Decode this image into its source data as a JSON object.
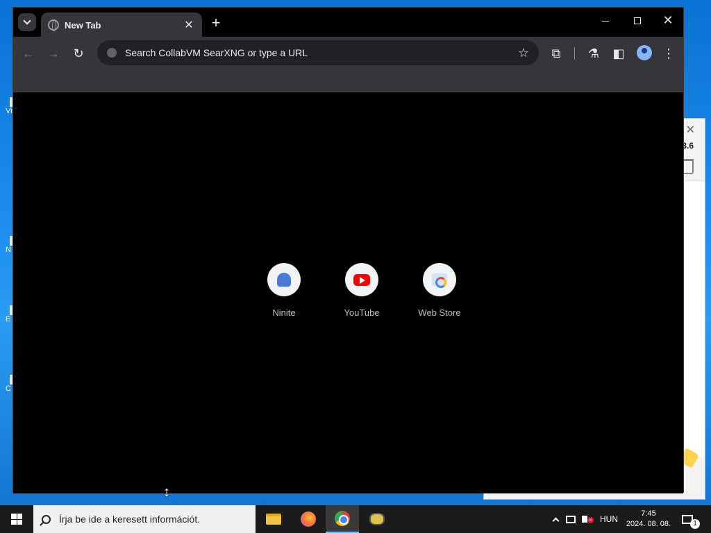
{
  "browser": {
    "tab_title": "New Tab",
    "omnibox_placeholder": "Search CollabVM SearXNG or type a URL",
    "shortcuts": [
      {
        "label": "Ninite",
        "icon": "ninite-icon"
      },
      {
        "label": "YouTube",
        "icon": "youtube-icon"
      },
      {
        "label": "Web Store",
        "icon": "web-store-icon"
      }
    ]
  },
  "background_window": {
    "version_fragment": "3.6"
  },
  "desktop_fragments": [
    "Vi",
    "N",
    "E",
    "C"
  ],
  "taskbar": {
    "search_placeholder": "Írja be ide a keresett információt.",
    "language": "HUN",
    "time": "7:45",
    "date": "2024. 08. 08.",
    "notification_count": "1",
    "apps": [
      "file-explorer-icon",
      "firefox-icon",
      "chrome-icon",
      "bee-app-icon"
    ]
  },
  "colors": {
    "chrome_frame": "#35363a",
    "omnibox_bg": "#202124",
    "content_bg": "#000000",
    "taskbar_bg": "#1b1b1b",
    "desktop_blue": "#1e90f0"
  }
}
